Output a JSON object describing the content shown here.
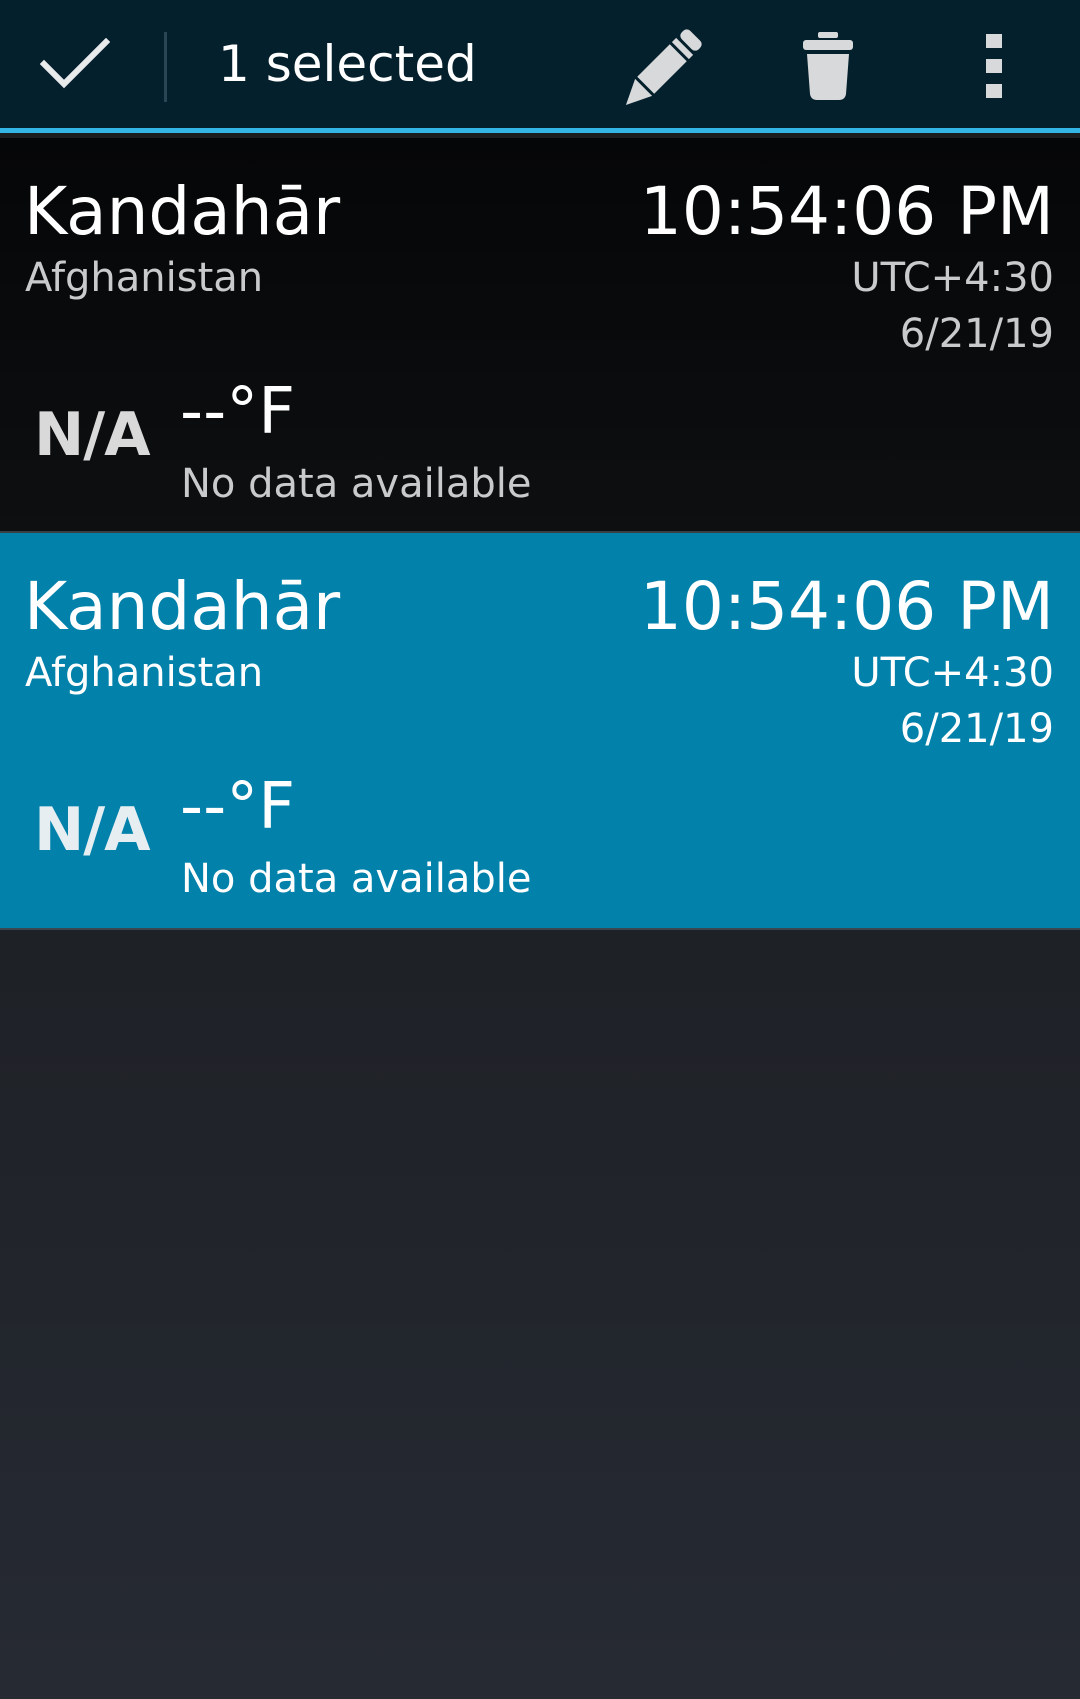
{
  "action_bar": {
    "selection_text": "1 selected",
    "done_icon": "check-icon",
    "actions": [
      {
        "name": "edit",
        "icon": "pencil-icon"
      },
      {
        "name": "delete",
        "icon": "trash-icon"
      },
      {
        "name": "overflow",
        "icon": "overflow-menu-icon"
      }
    ],
    "accent_color": "#33b5e5",
    "background_color": "#05202d"
  },
  "clocks": [
    {
      "city": "Kandahār",
      "country": "Afghanistan",
      "time": "10:54:06 PM",
      "utc_offset": "UTC+4:30",
      "date": "6/21/19",
      "weather_icon_text": "N/A",
      "temperature": "--°F",
      "condition": "No data available",
      "selected": false
    },
    {
      "city": "Kandahār",
      "country": "Afghanistan",
      "time": "10:54:06 PM",
      "utc_offset": "UTC+4:30",
      "date": "6/21/19",
      "weather_icon_text": "N/A",
      "temperature": "--°F",
      "condition": "No data available",
      "selected": true
    }
  ],
  "selected_item_color": "#0281ab"
}
